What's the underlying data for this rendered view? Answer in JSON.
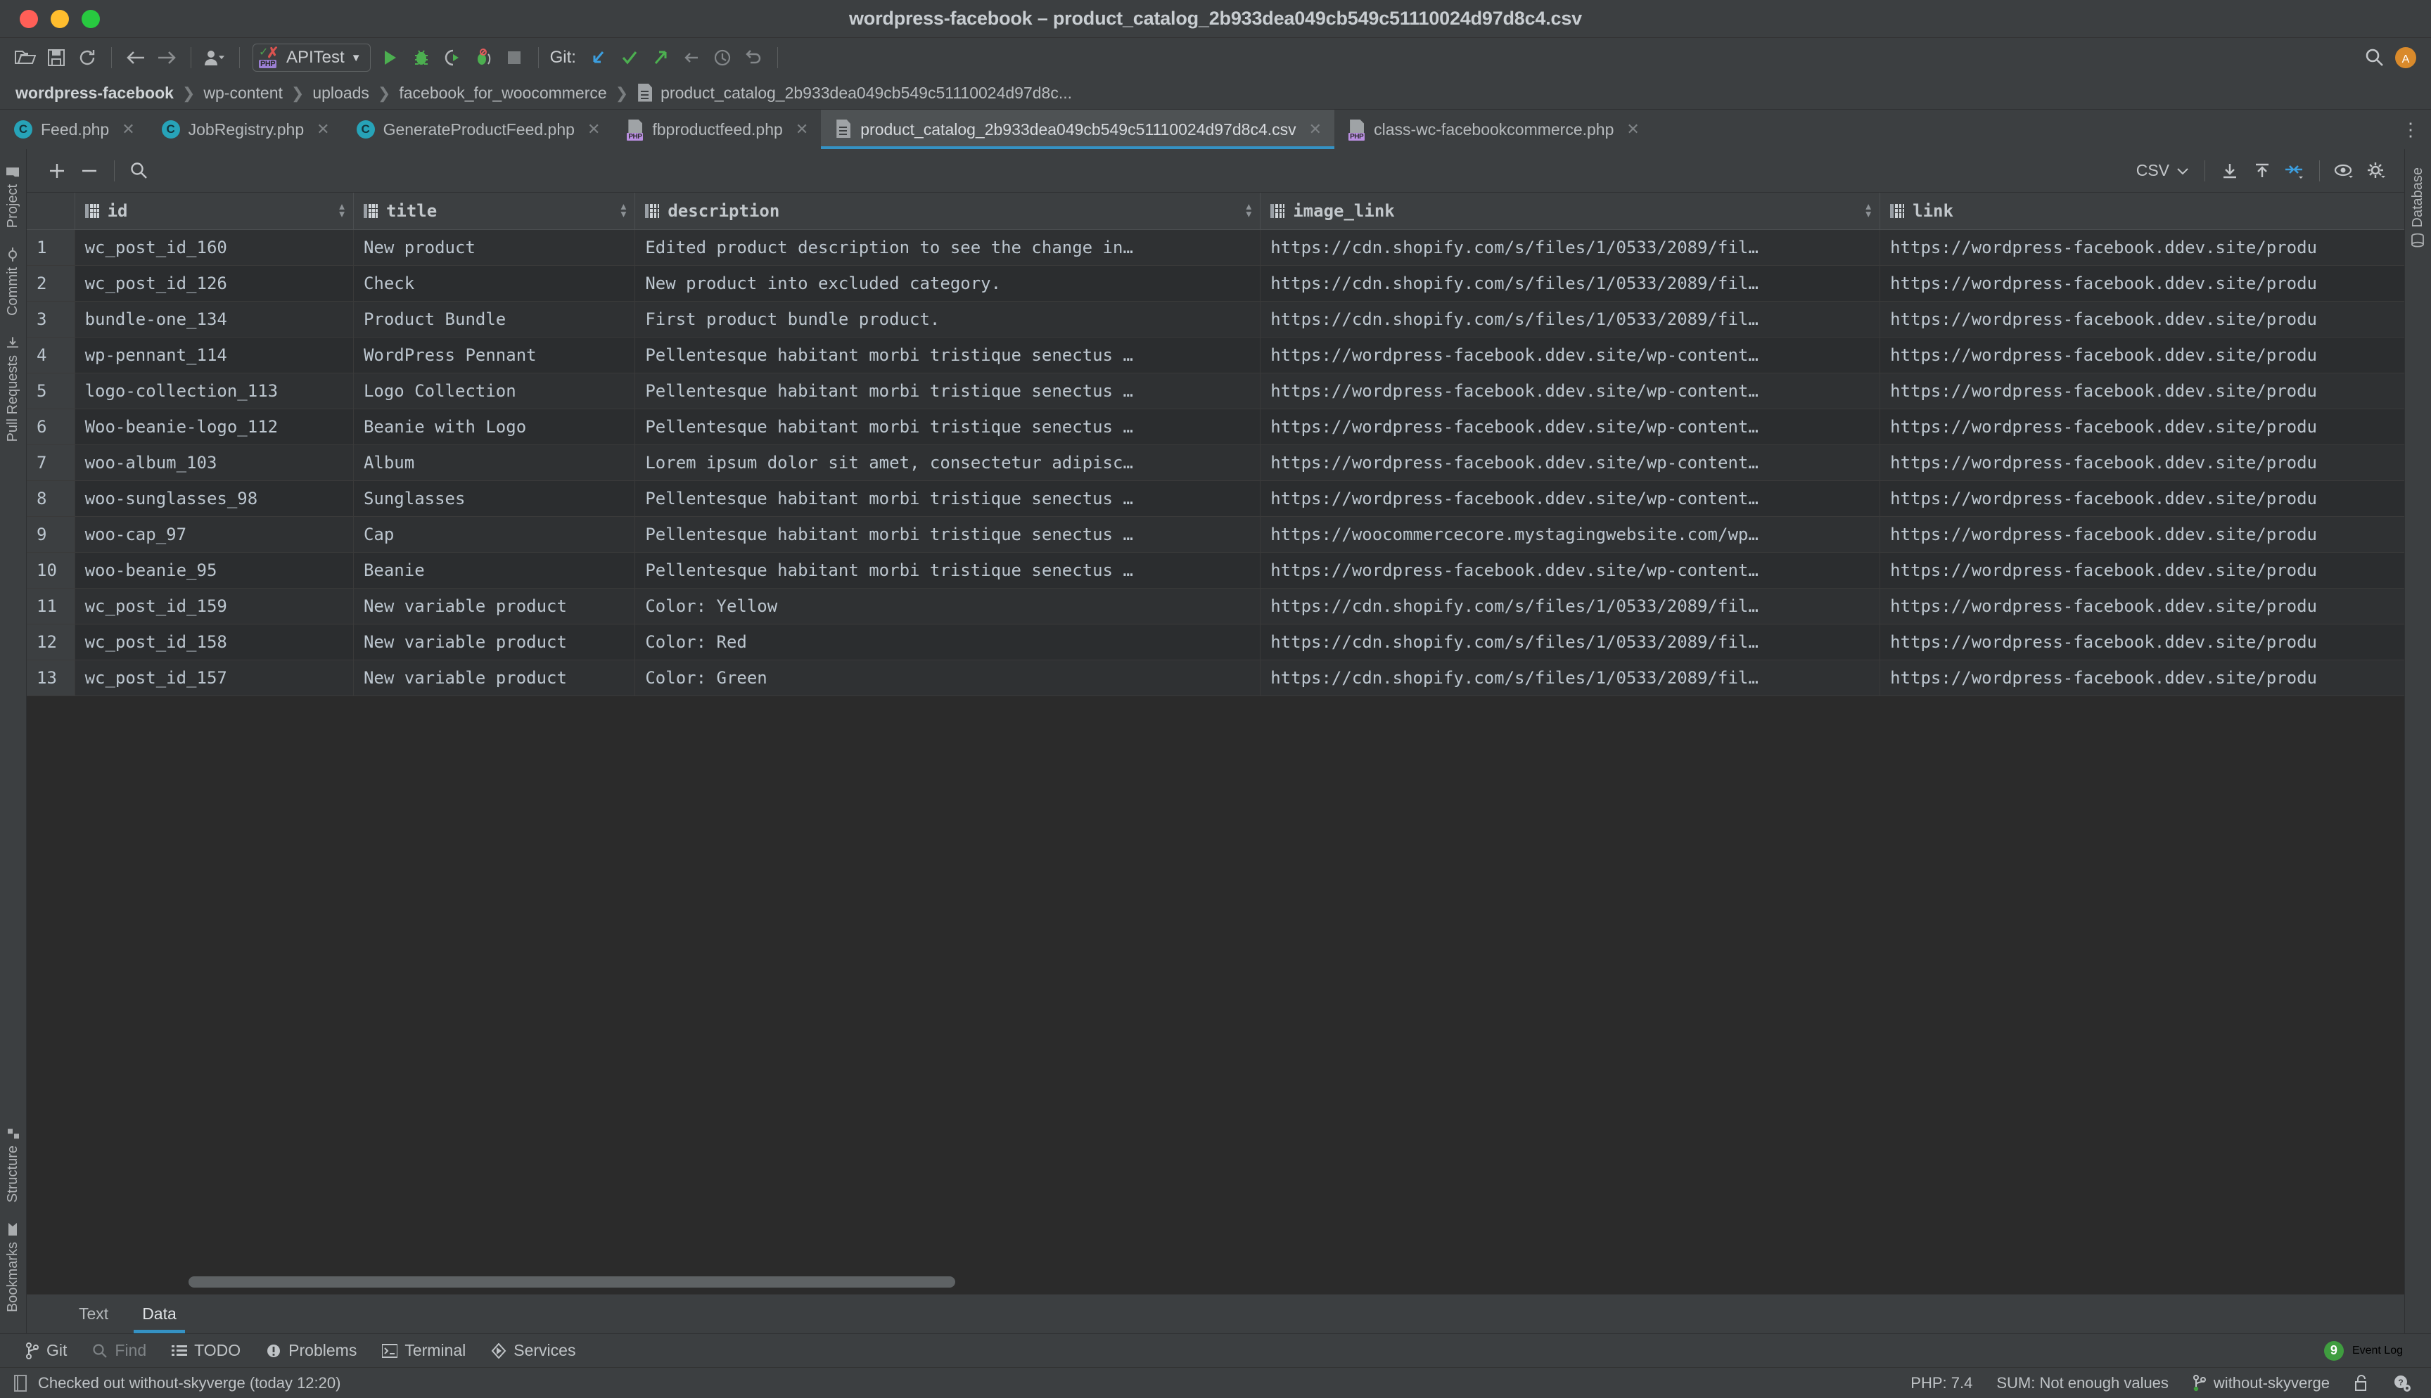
{
  "window": {
    "title": "wordpress-facebook – product_catalog_2b933dea049cb549c51110024d97d8c4.csv",
    "traffic_lights": [
      "close",
      "minimize",
      "zoom"
    ]
  },
  "toolbar": {
    "icons": [
      "open-folder-icon",
      "save-icon",
      "sync-icon",
      "back-arrow-icon",
      "forward-arrow-icon",
      "user-avatar-icon"
    ],
    "run_config": {
      "name": "APITest",
      "icon": "php-test-icon"
    },
    "run_label": "Run",
    "debug_label": "Debug",
    "coverage_label": "Run with Coverage",
    "profile_label": "Profile",
    "stop_label": "Stop",
    "git_label": "Git:",
    "git_actions": [
      "update-project-icon",
      "commit-icon",
      "push-icon",
      "rebase-icon",
      "history-icon",
      "rollback-icon"
    ],
    "search_label": "Search Everywhere",
    "avatar_label": "A"
  },
  "breadcrumb": {
    "items": [
      {
        "label": "wordpress-facebook",
        "root": true
      },
      {
        "label": "wp-content",
        "root": false
      },
      {
        "label": "uploads",
        "root": false
      },
      {
        "label": "facebook_for_woocommerce",
        "root": false
      },
      {
        "label": "product_catalog_2b933dea049cb549c51110024d97d8c...",
        "root": false,
        "icon": "csv-file-icon"
      }
    ]
  },
  "editor_tabs": [
    {
      "label": "Feed.php",
      "icon": "php-class-icon",
      "active": false
    },
    {
      "label": "JobRegistry.php",
      "icon": "php-class-icon",
      "active": false
    },
    {
      "label": "GenerateProductFeed.php",
      "icon": "php-class-icon",
      "active": false
    },
    {
      "label": "fbproductfeed.php",
      "icon": "php-file-icon",
      "active": false
    },
    {
      "label": "product_catalog_2b933dea049cb549c51110024d97d8c4.csv",
      "icon": "csv-file-icon",
      "active": true
    },
    {
      "label": "class-wc-facebookcommerce.php",
      "icon": "php-file-icon",
      "active": false
    }
  ],
  "grid_toolbar": {
    "add_row_label": "+",
    "delete_row_label": "−",
    "search_label": "Search",
    "format_value": "CSV",
    "import_label": "Import Data",
    "export_label": "Export Data",
    "transpose_label": "Transpose",
    "view_label": "View Options",
    "settings_label": "Data Settings"
  },
  "table": {
    "columns": [
      {
        "name": "id",
        "sortable": true
      },
      {
        "name": "title",
        "sortable": true
      },
      {
        "name": "description",
        "sortable": true
      },
      {
        "name": "image_link",
        "sortable": true
      },
      {
        "name": "link",
        "sortable": true
      }
    ],
    "rows": [
      {
        "n": "1",
        "id": "wc_post_id_160",
        "title": "New product",
        "description": "Edited product description to see the change in…",
        "image_link": "https://cdn.shopify.com/s/files/1/0533/2089/fil…",
        "link": "https://wordpress-facebook.ddev.site/produ"
      },
      {
        "n": "2",
        "id": "wc_post_id_126",
        "title": "Check",
        "description": "New product into excluded category.",
        "image_link": "https://cdn.shopify.com/s/files/1/0533/2089/fil…",
        "link": "https://wordpress-facebook.ddev.site/produ"
      },
      {
        "n": "3",
        "id": "bundle-one_134",
        "title": "Product Bundle",
        "description": "First product bundle product.",
        "image_link": "https://cdn.shopify.com/s/files/1/0533/2089/fil…",
        "link": "https://wordpress-facebook.ddev.site/produ"
      },
      {
        "n": "4",
        "id": "wp-pennant_114",
        "title": "WordPress Pennant",
        "description": "Pellentesque habitant morbi tristique senectus …",
        "image_link": "https://wordpress-facebook.ddev.site/wp-content…",
        "link": "https://wordpress-facebook.ddev.site/produ"
      },
      {
        "n": "5",
        "id": "logo-collection_113",
        "title": "Logo Collection",
        "description": "Pellentesque habitant morbi tristique senectus …",
        "image_link": "https://wordpress-facebook.ddev.site/wp-content…",
        "link": "https://wordpress-facebook.ddev.site/produ"
      },
      {
        "n": "6",
        "id": "Woo-beanie-logo_112",
        "title": "Beanie with Logo",
        "description": "Pellentesque habitant morbi tristique senectus …",
        "image_link": "https://wordpress-facebook.ddev.site/wp-content…",
        "link": "https://wordpress-facebook.ddev.site/produ"
      },
      {
        "n": "7",
        "id": "woo-album_103",
        "title": "Album",
        "description": "Lorem ipsum dolor sit amet, consectetur adipisc…",
        "image_link": "https://wordpress-facebook.ddev.site/wp-content…",
        "link": "https://wordpress-facebook.ddev.site/produ"
      },
      {
        "n": "8",
        "id": "woo-sunglasses_98",
        "title": "Sunglasses",
        "description": "Pellentesque habitant morbi tristique senectus …",
        "image_link": "https://wordpress-facebook.ddev.site/wp-content…",
        "link": "https://wordpress-facebook.ddev.site/produ"
      },
      {
        "n": "9",
        "id": "woo-cap_97",
        "title": "Cap",
        "description": "Pellentesque habitant morbi tristique senectus …",
        "image_link": "https://woocommercecore.mystagingwebsite.com/wp…",
        "link": "https://wordpress-facebook.ddev.site/produ"
      },
      {
        "n": "10",
        "id": "woo-beanie_95",
        "title": "Beanie",
        "description": "Pellentesque habitant morbi tristique senectus …",
        "image_link": "https://wordpress-facebook.ddev.site/wp-content…",
        "link": "https://wordpress-facebook.ddev.site/produ"
      },
      {
        "n": "11",
        "id": "wc_post_id_159",
        "title": "New variable product",
        "description": "Color: Yellow",
        "image_link": "https://cdn.shopify.com/s/files/1/0533/2089/fil…",
        "link": "https://wordpress-facebook.ddev.site/produ"
      },
      {
        "n": "12",
        "id": "wc_post_id_158",
        "title": "New variable product",
        "description": "Color: Red",
        "image_link": "https://cdn.shopify.com/s/files/1/0533/2089/fil…",
        "link": "https://wordpress-facebook.ddev.site/produ"
      },
      {
        "n": "13",
        "id": "wc_post_id_157",
        "title": "New variable product",
        "description": "Color: Green",
        "image_link": "https://cdn.shopify.com/s/files/1/0533/2089/fil…",
        "link": "https://wordpress-facebook.ddev.site/produ"
      }
    ]
  },
  "view_tabs": [
    {
      "label": "Text",
      "active": false
    },
    {
      "label": "Data",
      "active": true
    }
  ],
  "left_rail": {
    "top": [
      {
        "label": "Project",
        "icon": "folder-icon"
      },
      {
        "label": "Commit",
        "icon": "commit-icon"
      },
      {
        "label": "Pull Requests",
        "icon": "pull-request-icon"
      }
    ],
    "bottom": [
      {
        "label": "Structure",
        "icon": "structure-icon"
      },
      {
        "label": "Bookmarks",
        "icon": "bookmark-icon"
      }
    ]
  },
  "right_rail": {
    "items": [
      {
        "label": "Database",
        "icon": "database-icon"
      }
    ]
  },
  "tool_window_bar": {
    "items": [
      {
        "label": "Git",
        "icon": "branch-icon",
        "dim": false
      },
      {
        "label": "Find",
        "icon": "search-icon",
        "dim": true
      },
      {
        "label": "TODO",
        "icon": "list-icon",
        "dim": false
      },
      {
        "label": "Problems",
        "icon": "warning-icon",
        "dim": false
      },
      {
        "label": "Terminal",
        "icon": "terminal-icon",
        "dim": false
      },
      {
        "label": "Services",
        "icon": "services-icon",
        "dim": false
      }
    ],
    "event_log": {
      "label": "Event Log",
      "count": "9"
    }
  },
  "status_bar": {
    "message": "Checked out without-skyverge (today 12:20)",
    "php_version": "PHP: 7.4",
    "sum": "SUM: Not enough values",
    "branch": "without-skyverge",
    "lock_icon": "unlocked-icon",
    "ide_icon": "ide-helper-icon"
  },
  "colors": {
    "accent": "#3592c4",
    "toolbar_bg": "#3c3f41",
    "grid_bg": "#2b2b2b",
    "row_odd": "#2f3133",
    "text": "#bcc6cf",
    "green": "#3f9d3f",
    "csv_icon": "#9fa3a6"
  }
}
